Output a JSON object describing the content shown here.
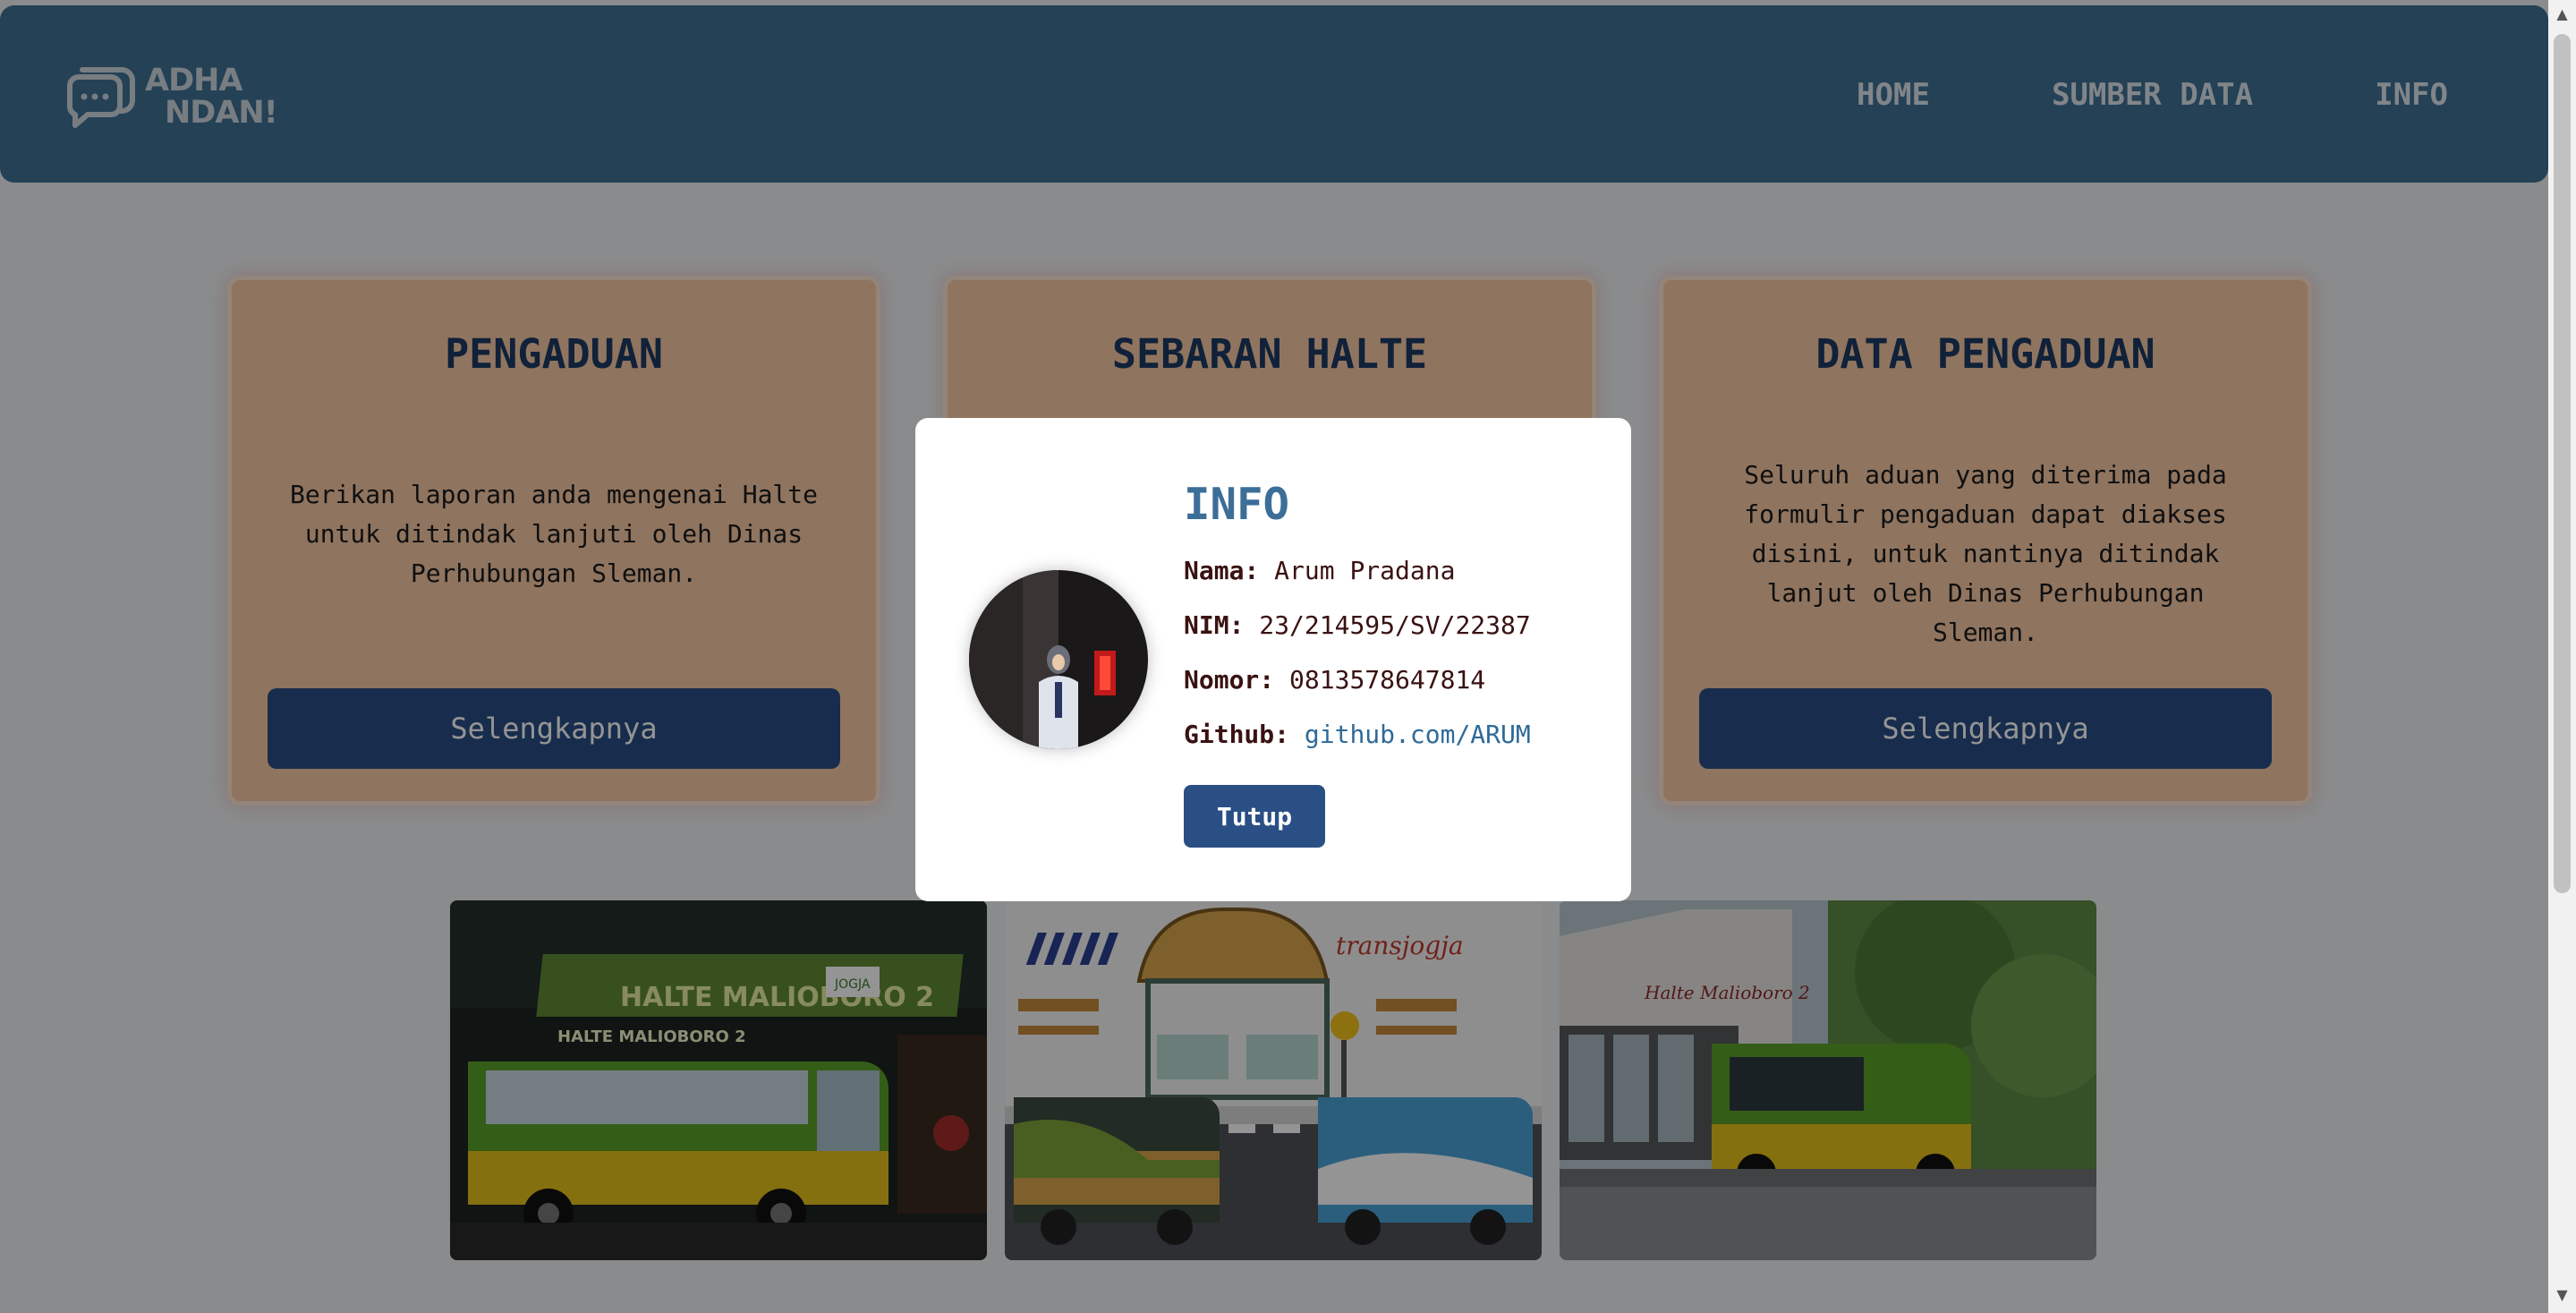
{
  "brand": {
    "line1": "ADHA",
    "line2": "NDAN!",
    "icon": "chat-bubbles-icon"
  },
  "nav": {
    "items": [
      "HOME",
      "SUMBER DATA",
      "INFO"
    ]
  },
  "cards": [
    {
      "title": "PENGADUAN",
      "desc": "Berikan laporan anda mengenai Halte untuk ditindak lanjuti oleh Dinas Perhubungan Sleman.",
      "button": "Selengkapnya"
    },
    {
      "title": "SEBARAN HALTE",
      "desc": "",
      "button": ""
    },
    {
      "title": "DATA PENGADUAN",
      "desc": "Seluruh aduan yang diterima pada formulir pengaduan dapat diakses disini, untuk nantinya ditindak lanjut oleh Dinas Perhubungan Sleman.",
      "button": "Selengkapnya"
    }
  ],
  "photos": {
    "photo1": {
      "sign": "HALTE MALIOBORO 2",
      "sign2": "HALTE MALIOBORO 2",
      "badge": "JOGJA"
    },
    "photo2": {
      "brand": "transjogja"
    },
    "photo3": {
      "sign": "Halte Malioboro 2"
    }
  },
  "modal": {
    "title": "INFO",
    "nama_label": "Nama:",
    "nama": "Arum Pradana",
    "nim_label": "NIM:",
    "nim": "23/214595/SV/22387",
    "nomor_label": "Nomor:",
    "nomor": "0813578647814",
    "github_label": "Github:",
    "github": "github.com/ARUM",
    "close": "Tutup"
  },
  "colors": {
    "navbar": "#3f7194",
    "card_bg": "#f7c8a4",
    "button": "#2a4f85",
    "title": "#1d3a62",
    "modal_title": "#3c6e98"
  }
}
